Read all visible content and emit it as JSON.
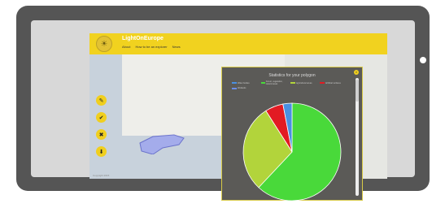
{
  "header": {
    "title": "LightOnEurope",
    "nav": [
      "About",
      "How to be an explorer",
      "News"
    ]
  },
  "panel": {
    "title": "Statistics for your polygon",
    "legend": [
      {
        "label": "Water bodies",
        "color": "#4a90e2"
      },
      {
        "label": "Forest, vegetation, natural areas",
        "color": "#49d93a"
      },
      {
        "label": "Agricultural areas",
        "color": "#b2d43b"
      },
      {
        "label": "Artificial surfaces",
        "color": "#e21b23"
      },
      {
        "label": "Wetlands",
        "color": "#6b8ee8"
      }
    ]
  },
  "chart_data": {
    "type": "pie",
    "title": "Statistics for your polygon",
    "series": [
      {
        "name": "Forest, vegetation, natural areas",
        "value": 62
      },
      {
        "name": "Agricultural areas",
        "value": 29
      },
      {
        "name": "Artificial surfaces",
        "value": 6
      },
      {
        "name": "Water bodies",
        "value": 3
      }
    ]
  },
  "tools": [
    {
      "icon": "pencil-icon"
    },
    {
      "icon": "check-icon"
    },
    {
      "icon": "close-icon"
    },
    {
      "icon": "download-icon"
    }
  ],
  "footer": {
    "text": "Copyright 2015"
  }
}
